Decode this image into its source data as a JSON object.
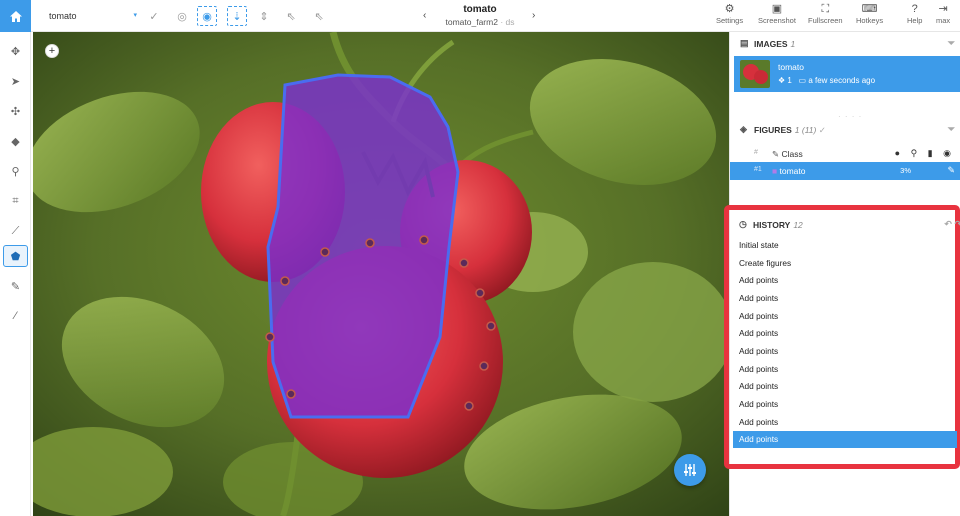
{
  "topbar": {
    "class_select": "tomato",
    "title": "tomato",
    "subtitle_main": "tomato_farm2",
    "subtitle_sep": " · ds",
    "right_buttons": [
      {
        "label": "Settings",
        "icon": "gear-icon"
      },
      {
        "label": "Screenshot",
        "icon": "camera-icon"
      },
      {
        "label": "Fullscreen",
        "icon": "fullscreen-icon"
      },
      {
        "label": "Hotkeys",
        "icon": "keyboard-icon"
      },
      {
        "label": "Help",
        "icon": "question-icon"
      },
      {
        "label": "max",
        "icon": "logout-icon"
      }
    ]
  },
  "images_section": {
    "title": "IMAGES",
    "count": "1",
    "image": {
      "name": "tomato",
      "figures": "1",
      "time": "a few seconds ago"
    }
  },
  "figures_section": {
    "title": "FIGURES",
    "count": "1 (11)",
    "rows": [
      {
        "label": "Class",
        "prefix": "#",
        "value": ""
      },
      {
        "label": "tomato",
        "prefix": "#1",
        "value": "3%"
      }
    ]
  },
  "history_section": {
    "title": "HISTORY",
    "count": "12",
    "items": [
      "Initial state",
      "Create figures",
      "Add points",
      "Add points",
      "Add points",
      "Add points",
      "Add points",
      "Add points",
      "Add points",
      "Add points",
      "Add points",
      "Add points"
    ],
    "selected_index": 11
  },
  "colors": {
    "accent": "#3d9be9",
    "highlight_frame": "#e8333f",
    "polygon_fill": "#7b2fd0"
  }
}
